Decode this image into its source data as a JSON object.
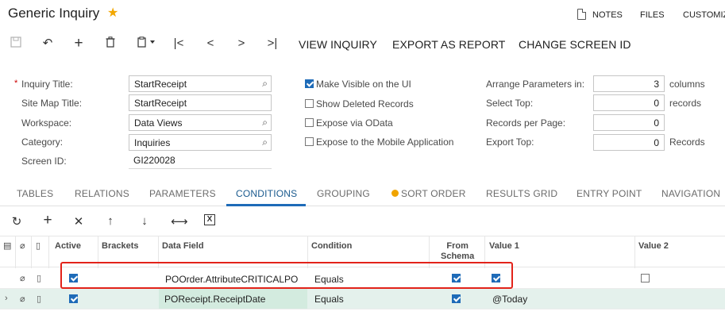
{
  "header": {
    "title": "Generic Inquiry",
    "notes_label": "NOTES",
    "files_label": "FILES",
    "customize_label": "CUSTOMIZ"
  },
  "toolbar": {
    "view_inquiry": "VIEW INQUIRY",
    "export_as_report": "EXPORT AS REPORT",
    "change_screen_id": "CHANGE SCREEN ID"
  },
  "form": {
    "inquiry_title_label": "Inquiry Title:",
    "inquiry_title_value": "StartReceipt",
    "site_map_title_label": "Site Map Title:",
    "site_map_title_value": "StartReceipt",
    "workspace_label": "Workspace:",
    "workspace_value": "Data Views",
    "category_label": "Category:",
    "category_value": "Inquiries",
    "screen_id_label": "Screen ID:",
    "screen_id_value": "GI220028",
    "make_visible_label": "Make Visible on the UI",
    "show_deleted_label": "Show Deleted Records",
    "expose_odata_label": "Expose via OData",
    "expose_mobile_label": "Expose to the Mobile Application",
    "arrange_params_label": "Arrange Parameters in:",
    "arrange_params_value": "3",
    "arrange_params_suffix": "columns",
    "select_top_label": "Select Top:",
    "select_top_value": "0",
    "select_top_suffix": "records",
    "records_per_page_label": "Records per Page:",
    "records_per_page_value": "0",
    "export_top_label": "Export Top:",
    "export_top_value": "0",
    "export_top_suffix": "Records",
    "required_mark": "*"
  },
  "tabs": [
    "TABLES",
    "RELATIONS",
    "PARAMETERS",
    "CONDITIONS",
    "GROUPING",
    "SORT ORDER",
    "RESULTS GRID",
    "ENTRY POINT",
    "NAVIGATION"
  ],
  "active_tab": "CONDITIONS",
  "grid": {
    "columns": {
      "active": "Active",
      "brackets": "Brackets",
      "data_field": "Data Field",
      "condition": "Condition",
      "from_schema_1": "From",
      "from_schema_2": "Schema",
      "value1": "Value 1",
      "value2": "Value 2"
    },
    "rows": [
      {
        "active": true,
        "data_field": "POOrder.AttributeCRITICALPO",
        "condition": "Equals",
        "from_schema": true,
        "value1_checked": true,
        "value1": "",
        "value2_checkbox": true
      },
      {
        "active": true,
        "data_field": "POReceipt.ReceiptDate",
        "condition": "Equals",
        "from_schema": true,
        "value1_checked": false,
        "value1": "@Today",
        "value2_checkbox": false
      }
    ]
  },
  "colors": {
    "accent": "#1e6bb8",
    "highlight": "#e2231a",
    "star": "#f2a700",
    "selected_row": "#e4f1ec"
  }
}
